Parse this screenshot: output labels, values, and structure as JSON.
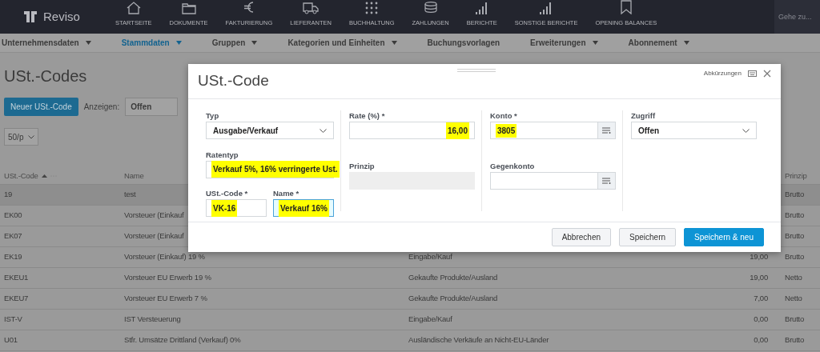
{
  "app": {
    "logo": "Reviso",
    "search": {
      "placeholder": "Gehe zu..."
    }
  },
  "nav": [
    {
      "label": "STARTSEITE"
    },
    {
      "label": "DOKUMENTE"
    },
    {
      "label": "FAKTURIERUNG"
    },
    {
      "label": "LIEFERANTEN"
    },
    {
      "label": "BUCHHALTUNG"
    },
    {
      "label": "ZAHLUNGEN"
    },
    {
      "label": "BERICHTE"
    },
    {
      "label": "SONSTIGE BERICHTE"
    },
    {
      "label": "OPENING BALANCES"
    }
  ],
  "subnav": [
    {
      "label": "Unternehmensdaten",
      "dropdown": true,
      "selected": false
    },
    {
      "label": "Stammdaten",
      "dropdown": true,
      "selected": true
    },
    {
      "label": "Gruppen",
      "dropdown": true,
      "selected": false
    },
    {
      "label": "Kategorien und Einheiten",
      "dropdown": true,
      "selected": false
    },
    {
      "label": "Buchungsvorlagen",
      "dropdown": false,
      "selected": false
    },
    {
      "label": "Erweiterungen",
      "dropdown": true,
      "selected": false
    },
    {
      "label": "Abonnement",
      "dropdown": true,
      "selected": false
    }
  ],
  "page": {
    "title": "USt.-Codes",
    "new_button": "Neuer USt.-Code",
    "show_label": "Anzeigen:",
    "show_value": "Offen",
    "page_size": "50/p"
  },
  "table": {
    "columns": [
      {
        "label": "USt.-Code",
        "sorted": true
      },
      {
        "label": "Name",
        "sorted": false
      },
      {
        "label": "Prinzip",
        "sorted": false
      }
    ],
    "rows": [
      {
        "code": "19",
        "name": "test",
        "prinzip": "Brutto",
        "selected": true
      },
      {
        "code": "EK00",
        "name": "Vorsteuer (Einkauf",
        "prinzip": "Brutto",
        "selected": false
      },
      {
        "code": "EK07",
        "name": "Vorsteuer (Einkauf",
        "prinzip": "Brutto",
        "selected": false
      },
      {
        "code": "EK19",
        "name": "Vorsteuer (Einkauf) 19 %",
        "column_3": "Eingabe/Kauf",
        "column_4": "19,00",
        "prinzip": "Brutto",
        "selected": false
      },
      {
        "code": "EKEU1",
        "name": "Vorsteuer EU Erwerb 19 %",
        "column_3": "Gekaufte Produkte/Ausland",
        "column_4": "19,00",
        "prinzip": "Netto",
        "selected": false
      },
      {
        "code": "EKEU7",
        "name": "Vorsteuer EU Erwerb 7 %",
        "column_3": "Gekaufte Produkte/Ausland",
        "column_4": "7,00",
        "prinzip": "Netto",
        "selected": false
      },
      {
        "code": "IST-V",
        "name": "IST Versteuerung",
        "column_3": "Eingabe/Kauf",
        "column_4": "0,00",
        "prinzip": "Brutto",
        "selected": false
      },
      {
        "code": "U01",
        "name": "Stfr. Umsätze Drittland (Verkauf) 0%",
        "column_3": "Ausländische Verkäufe an Nicht-EU-Länder",
        "column_4": "0,00",
        "prinzip": "Brutto",
        "selected": false
      }
    ]
  },
  "dialog": {
    "title": "USt.-Code",
    "shortcuts": "Abkürzungen",
    "columns": [
      [
        {
          "kind": "select",
          "label": "Typ",
          "value": "Ausgabe/Verkauf",
          "highlighted": false
        },
        {
          "kind": "select",
          "label": "Ratentyp",
          "value": "Verkauf 5%, 16% verringerte Ust.",
          "highlighted": true
        },
        {
          "kind": "pair",
          "fields": [
            {
              "kind": "input",
              "label": "USt.-Code *",
              "value": "VK-16",
              "highlighted": true,
              "focused": false
            },
            {
              "kind": "input",
              "label": "Name *",
              "value": "Verkauf 16%",
              "highlighted": true,
              "focused": true
            }
          ]
        }
      ],
      [
        {
          "kind": "number",
          "label": "Rate (%) *",
          "value": "16,00",
          "highlighted": true
        },
        {
          "kind": "readonly",
          "label": "Prinzip"
        }
      ],
      [
        {
          "kind": "lookup",
          "label": "Konto *",
          "value": "3805",
          "highlighted": true
        },
        {
          "kind": "lookup",
          "label": "Gegenkonto"
        }
      ],
      [
        {
          "kind": "select",
          "label": "Zugriff",
          "value": "Offen",
          "highlighted": false
        }
      ]
    ],
    "buttons": [
      {
        "label": "Abbrechen",
        "primary": false
      },
      {
        "label": "Speichern",
        "primary": false
      },
      {
        "label": "Speichern & neu",
        "primary": true
      }
    ]
  }
}
